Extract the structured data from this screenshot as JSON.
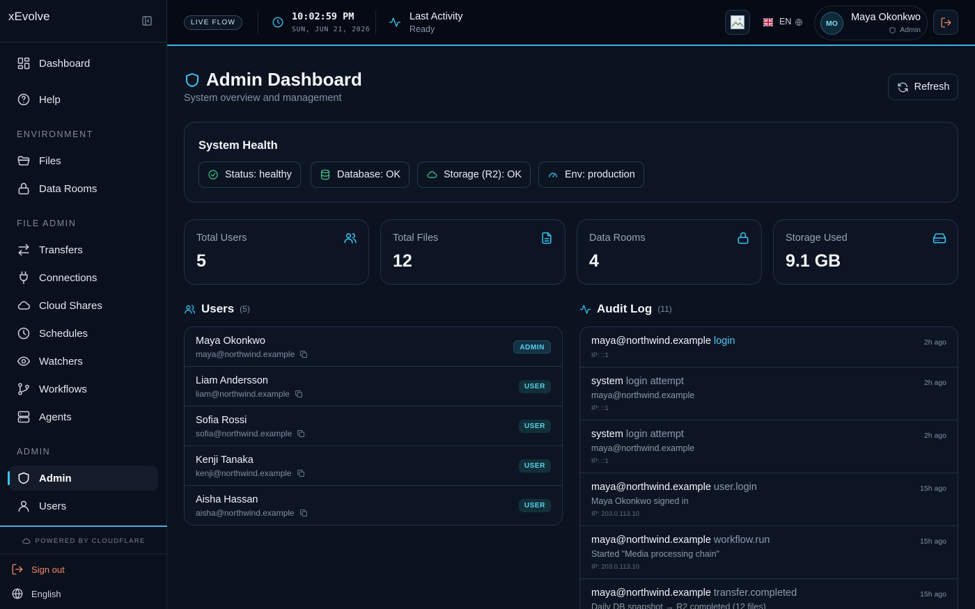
{
  "sidebar": {
    "brand": "xEvolve",
    "items": [
      {
        "label": "Dashboard"
      },
      {
        "label": "Help"
      }
    ],
    "sections": {
      "environment": "ENVIRONMENT",
      "file_admin": "FILE ADMIN",
      "admin": "ADMIN"
    },
    "environment_items": [
      {
        "label": "Files"
      },
      {
        "label": "Data Rooms"
      }
    ],
    "file_admin_items": [
      {
        "label": "Transfers"
      },
      {
        "label": "Connections"
      },
      {
        "label": "Cloud Shares"
      },
      {
        "label": "Schedules"
      },
      {
        "label": "Watchers"
      },
      {
        "label": "Workflows"
      },
      {
        "label": "Agents"
      }
    ],
    "admin_items": [
      {
        "label": "Admin",
        "active": true
      },
      {
        "label": "Users"
      }
    ],
    "powered_by": "POWERED BY CLOUDFLARE",
    "sign_out": "Sign out",
    "language": "English"
  },
  "header": {
    "live_badge": "LIVE FLOW",
    "time": "10:02:59 PM",
    "date": "SUN, JUN 21, 2026",
    "activity_title": "Last Activity",
    "activity_status": "Ready",
    "lang_code": "EN",
    "user": {
      "initials": "MO",
      "name": "Maya Okonkwo",
      "role": "Admin"
    }
  },
  "page": {
    "title": "Admin Dashboard",
    "subtitle": "System overview and management",
    "refresh_label": "Refresh"
  },
  "health": {
    "title": "System Health",
    "chips": [
      {
        "label": "Status: healthy"
      },
      {
        "label": "Database: OK"
      },
      {
        "label": "Storage (R2): OK"
      },
      {
        "label": "Env: production"
      }
    ]
  },
  "stats": [
    {
      "label": "Total Users",
      "value": "5"
    },
    {
      "label": "Total Files",
      "value": "12"
    },
    {
      "label": "Data Rooms",
      "value": "4"
    },
    {
      "label": "Storage Used",
      "value": "9.1 GB"
    }
  ],
  "users": {
    "title": "Users",
    "count": "(5)",
    "rows": [
      {
        "name": "Maya Okonkwo",
        "email": "maya@northwind.example",
        "role": "ADMIN"
      },
      {
        "name": "Liam Andersson",
        "email": "liam@northwind.example",
        "role": "USER"
      },
      {
        "name": "Sofia Rossi",
        "email": "sofia@northwind.example",
        "role": "USER"
      },
      {
        "name": "Kenji Tanaka",
        "email": "kenji@northwind.example",
        "role": "USER"
      },
      {
        "name": "Aisha Hassan",
        "email": "aisha@northwind.example",
        "role": "USER"
      }
    ]
  },
  "audit": {
    "title": "Audit Log",
    "count": "(11)",
    "rows": [
      {
        "actor": "maya@northwind.example",
        "action": "login",
        "detail": "",
        "ip": "IP: ::1",
        "time": "2h ago"
      },
      {
        "actor": "system",
        "action": "login attempt",
        "detail": "maya@northwind.example",
        "ip": "IP: ::1",
        "time": "2h ago"
      },
      {
        "actor": "system",
        "action": "login attempt",
        "detail": "maya@northwind.example",
        "ip": "IP: ::1",
        "time": "2h ago"
      },
      {
        "actor": "maya@northwind.example",
        "action": "user.login",
        "detail": "Maya Okonkwo signed in",
        "ip": "IP: 203.0.113.10",
        "time": "15h ago"
      },
      {
        "actor": "maya@northwind.example",
        "action": "workflow.run",
        "detail": "Started \"Media processing chain\"",
        "ip": "IP: 203.0.113.10",
        "time": "15h ago"
      },
      {
        "actor": "maya@northwind.example",
        "action": "transfer.completed",
        "detail": "Daily DB snapshot → R2 completed (12 files)",
        "ip": "",
        "time": "15h ago"
      }
    ]
  },
  "colors": {
    "accent": "#39c6f2",
    "success": "#3ccf8e",
    "danger": "#f08a6b",
    "background": "#0b1220"
  }
}
